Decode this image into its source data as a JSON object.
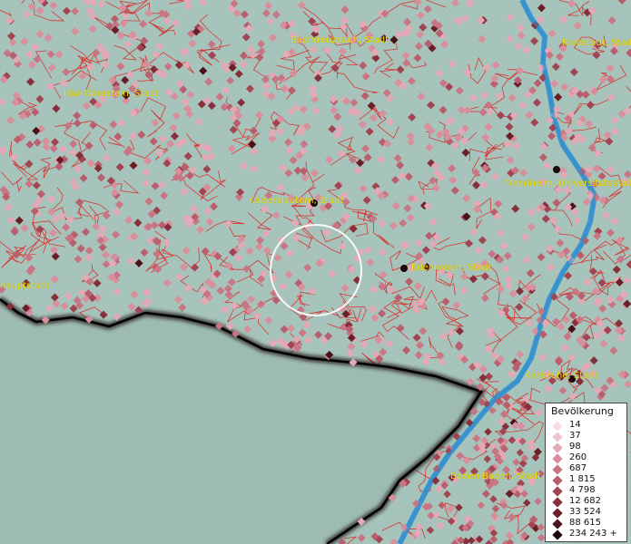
{
  "map": {
    "cities": [
      {
        "id": "bad-kreuznach",
        "name": "Bad Kreuznach, Stadt"
      },
      {
        "id": "riedstadt",
        "name": "Riedstadt, Stadt"
      },
      {
        "id": "idar-oberstein",
        "name": "Idar-Oberstein, Stadt"
      },
      {
        "id": "kaiserslautern",
        "name": "Kaiserslautern, Stadt"
      },
      {
        "id": "mannheim",
        "name": "Mannheim, Universitätsstadt"
      },
      {
        "id": "edenkoben",
        "name": "Edenkoben, Stadt"
      },
      {
        "id": "landeshauptstadt",
        "name": "hauptstadt"
      },
      {
        "id": "karlsruhe",
        "name": "Karlsruhe, Stadt"
      },
      {
        "id": "baden-baden",
        "name": "Baden-Baden, Stadt"
      }
    ],
    "colors": {
      "terrain": "#8fb0a8",
      "borders": "#e02020",
      "river": "#2f8fd0",
      "label": "#f2e000"
    }
  },
  "legend": {
    "title": "Bevölkerung",
    "classes": [
      {
        "label": "14",
        "color": "#f7dde6"
      },
      {
        "label": "37",
        "color": "#efc4cf"
      },
      {
        "label": "98",
        "color": "#e3a9b6"
      },
      {
        "label": "260",
        "color": "#d88f9c"
      },
      {
        "label": "687",
        "color": "#c97684"
      },
      {
        "label": "1 815",
        "color": "#b85e6c"
      },
      {
        "label": "4 798",
        "color": "#a14553"
      },
      {
        "label": "12 682",
        "color": "#86303c"
      },
      {
        "label": "33 524",
        "color": "#6a1f28"
      },
      {
        "label": "88 615",
        "color": "#4a1118"
      },
      {
        "label": "234 243 +",
        "color": "#1c0508"
      }
    ]
  }
}
